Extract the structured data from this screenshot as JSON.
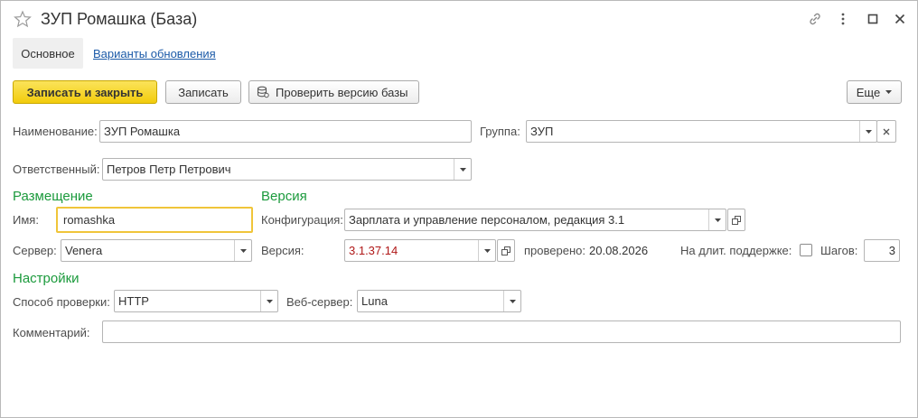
{
  "window": {
    "title": "ЗУП Ромашка (База)",
    "icons": [
      "star-icon",
      "link-icon",
      "more-vertical-icon",
      "maximize-icon",
      "close-icon"
    ]
  },
  "tabs": [
    {
      "label": "Основное",
      "active": true
    },
    {
      "label": "Варианты обновления",
      "active": false
    }
  ],
  "toolbar": {
    "save_close": "Записать и закрыть",
    "save": "Записать",
    "check_version": "Проверить версию базы",
    "more": "Еще"
  },
  "form": {
    "name_label": "Наименование:",
    "name_value": "ЗУП Ромашка",
    "group_label": "Группа:",
    "group_value": "ЗУП",
    "responsible_label": "Ответственный:",
    "responsible_value": "Петров Петр Петрович",
    "placement": {
      "header": "Размещение",
      "name_label": "Имя:",
      "name_value": "romashka",
      "server_label": "Сервер:",
      "server_value": "Venera"
    },
    "version": {
      "header": "Версия",
      "config_label": "Конфигурация:",
      "config_value": "Зарплата и управление персоналом, редакция 3.1",
      "version_label": "Версия:",
      "version_value": "3.1.37.14",
      "checked_label": "проверено:",
      "checked_value": "20.08.2026",
      "long_support_label": "На длит. поддержке:",
      "long_support_checked": false,
      "steps_label": "Шагов:",
      "steps_value": "3"
    },
    "settings": {
      "header": "Настройки",
      "method_label": "Способ проверки:",
      "method_value": "HTTP",
      "webserver_label": "Веб-сервер:",
      "webserver_value": "Luna"
    },
    "comment_label": "Комментарий:",
    "comment_value": ""
  },
  "colors": {
    "section": "#1b9a3c",
    "primary_button": "#f2cc0c",
    "link": "#1b5aa8",
    "version_text": "#b01818",
    "focus_border": "#f0c53a"
  }
}
